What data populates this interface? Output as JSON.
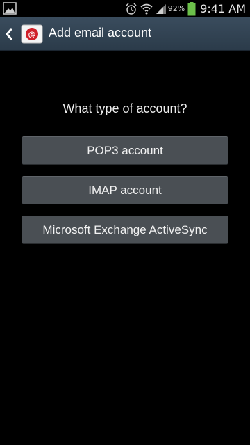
{
  "status_bar": {
    "left_icon": "gallery-icon",
    "icons": [
      "alarm-icon",
      "wifi-icon",
      "signal-icon",
      "battery-icon"
    ],
    "battery_percent": "92%",
    "time": "9:41 AM",
    "battery_color": "#6cc04a"
  },
  "action_bar": {
    "back_icon": "chevron-left-icon",
    "app_icon": "email-icon",
    "title": "Add email account",
    "accent": "#d0202a"
  },
  "main": {
    "prompt": "What type of account?",
    "options": [
      {
        "label": "POP3 account"
      },
      {
        "label": "IMAP account"
      },
      {
        "label": "Microsoft Exchange ActiveSync"
      }
    ]
  }
}
